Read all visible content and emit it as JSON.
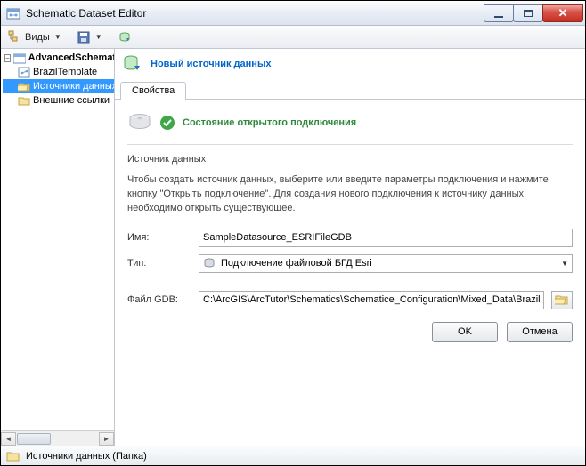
{
  "window": {
    "title": "Schematic Dataset Editor"
  },
  "toolbar": {
    "views_label": "Виды"
  },
  "header": {
    "link_text": "Новый источник данных"
  },
  "tree": {
    "root": "AdvancedSchemati",
    "items": [
      {
        "label": "BrazilTemplate"
      },
      {
        "label": "Источники данных"
      },
      {
        "label": "Внешние ссылки"
      }
    ]
  },
  "tabs": {
    "properties": "Свойства"
  },
  "status": {
    "text": "Состояние открытого подключения"
  },
  "section": {
    "title": "Источник данных",
    "description": "Чтобы создать источник данных, выберите или введите параметры подключения и нажмите кнопку \"Открыть подключение\". Для создания нового подключения к источнику данных необходимо открыть существующее."
  },
  "form": {
    "name_label": "Имя:",
    "name_value": "SampleDatasource_ESRIFileGDB",
    "type_label": "Тип:",
    "type_value": "Подключение файловой БГД Esri",
    "gdb_label": "Файл GDB:",
    "gdb_value": "C:\\ArcGIS\\ArcTutor\\Schematics\\Schematice_Configuration\\Mixed_Data\\Brazil.gdb"
  },
  "buttons": {
    "ok": "OK",
    "cancel": "Отмена"
  },
  "statusbar": {
    "text": "Источники данных (Папка)"
  }
}
